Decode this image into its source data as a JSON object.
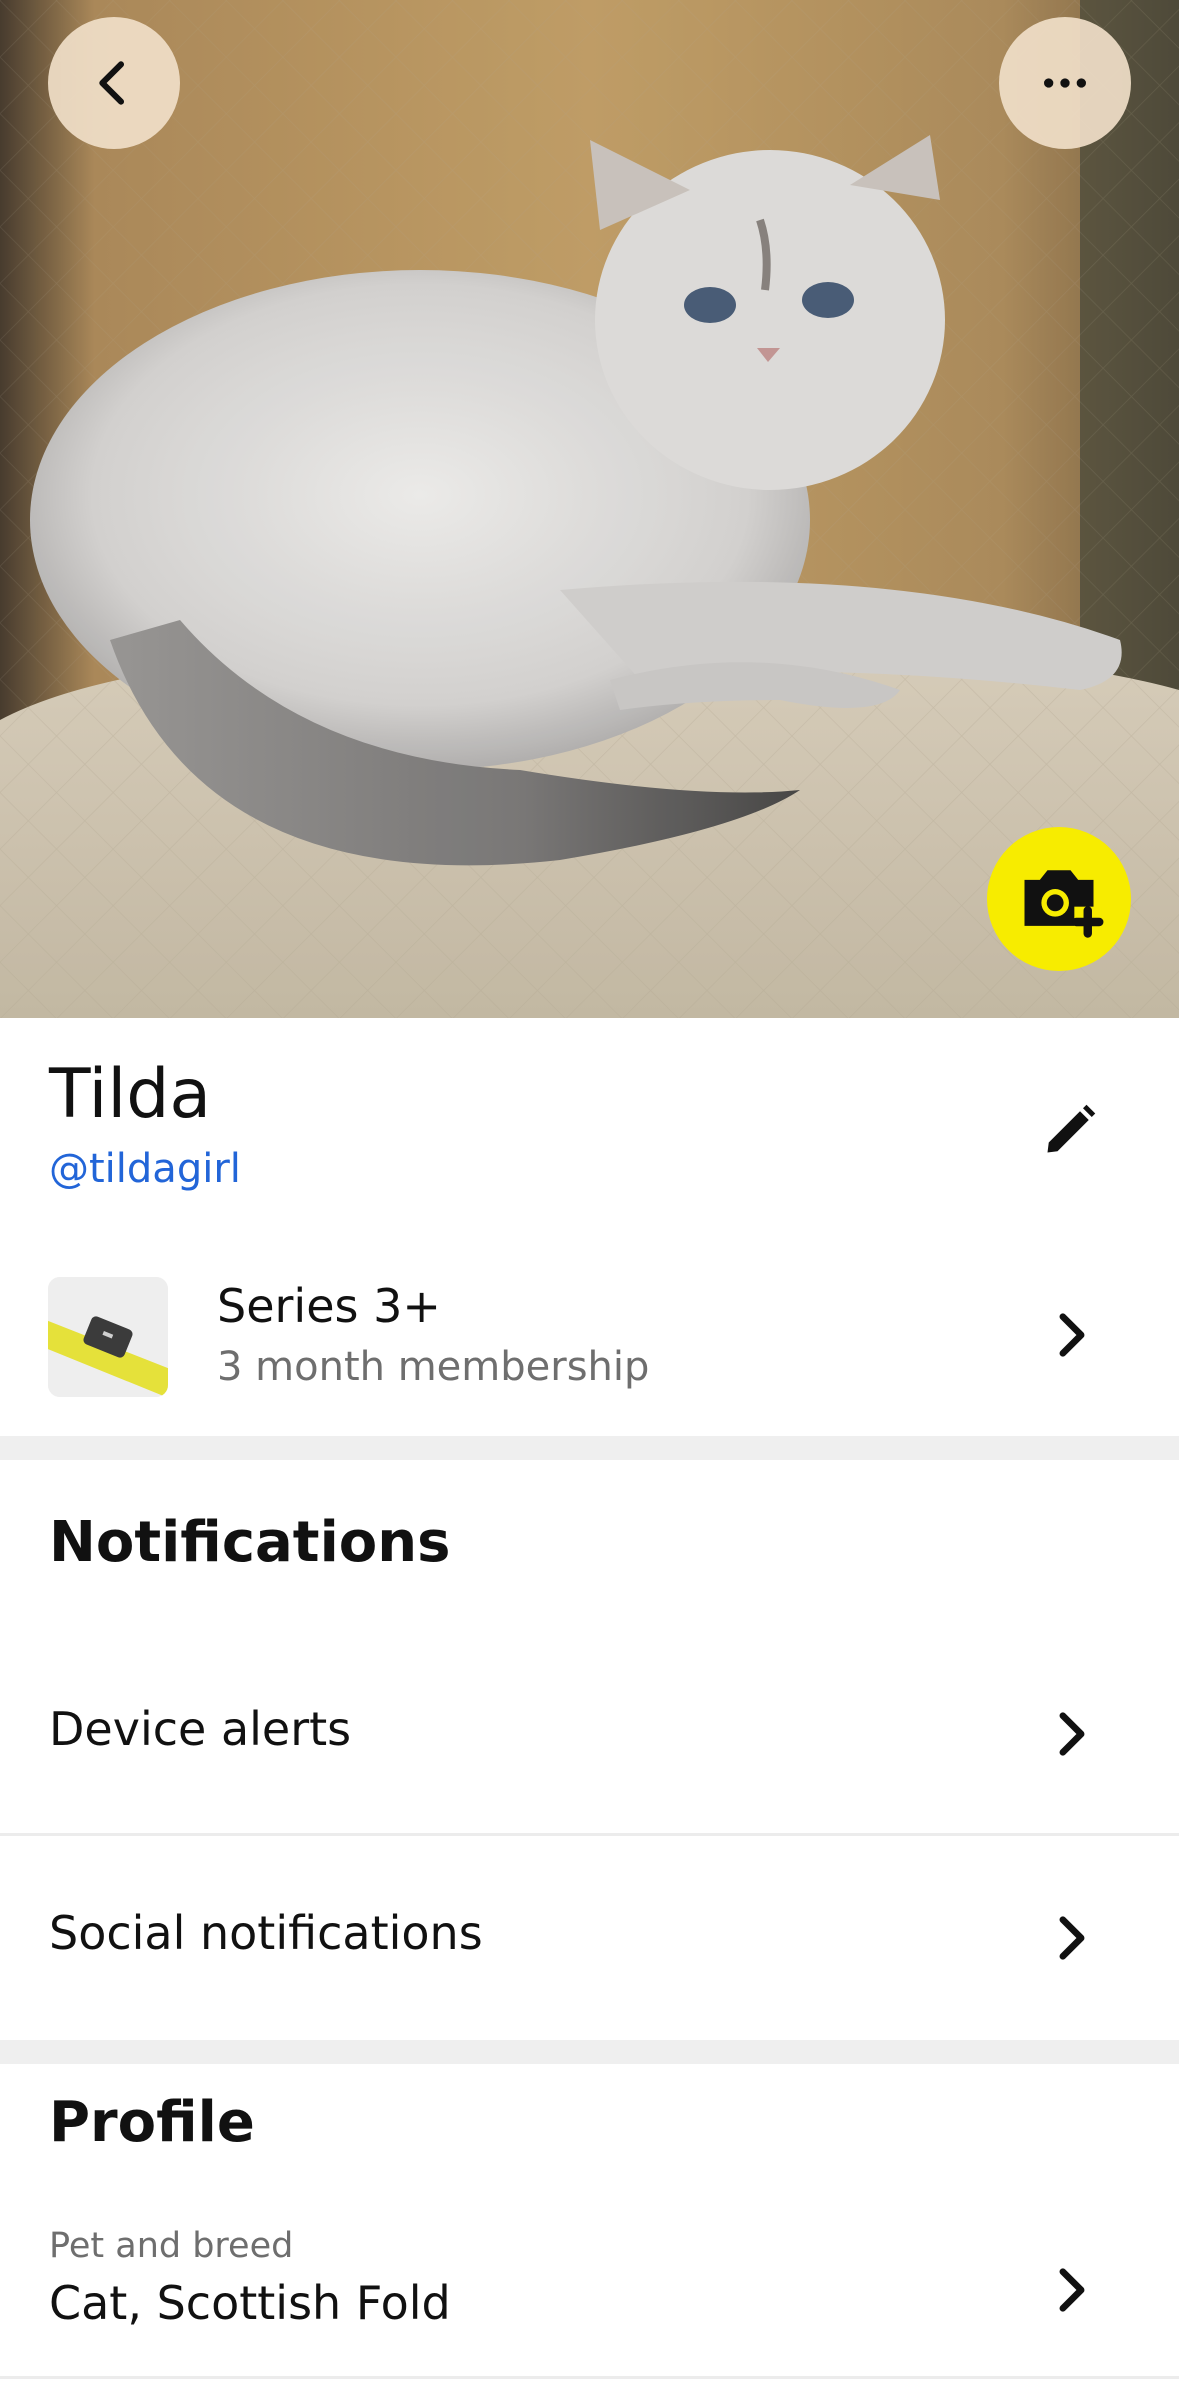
{
  "hero": {
    "back_icon": "chevron-left-icon",
    "more_icon": "more-horizontal-icon",
    "camera_icon": "camera-add-icon",
    "camera_button_color": "#f7ec00"
  },
  "pet": {
    "name": "Tilda",
    "handle": "@tildagirl",
    "edit_icon": "pencil-icon"
  },
  "membership": {
    "title": "Series 3+",
    "subtitle": "3 month membership",
    "thumb_icon": "collar-device-icon"
  },
  "notifications": {
    "heading": "Notifications",
    "items": [
      {
        "label": "Device alerts"
      },
      {
        "label": "Social notifications"
      }
    ]
  },
  "profile": {
    "heading": "Profile",
    "fields": [
      {
        "caption": "Pet and breed",
        "value": "Cat, Scottish Fold"
      }
    ]
  },
  "colors": {
    "link": "#2265d8",
    "accent_yellow": "#f7ec00",
    "section_gap": "#efefef"
  }
}
